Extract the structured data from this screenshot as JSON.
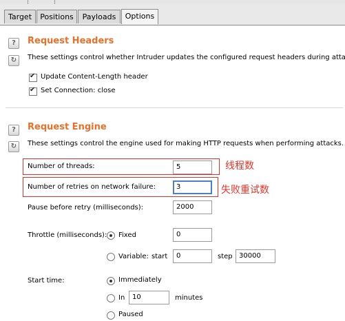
{
  "tabs": [
    {
      "label": "Target"
    },
    {
      "label": "Positions"
    },
    {
      "label": "Payloads"
    },
    {
      "label": "Options",
      "active": true
    }
  ],
  "request_headers": {
    "title": "Request Headers",
    "description": "These settings control whether Intruder updates the configured request headers during attacks.",
    "options": [
      {
        "label": "Update Content-Length header",
        "checked": true
      },
      {
        "label": "Set Connection: close",
        "checked": true
      }
    ]
  },
  "request_engine": {
    "title": "Request Engine",
    "description": "These settings control the engine used for making HTTP requests when performing attacks.",
    "threads": {
      "label": "Number of threads:",
      "value": "5",
      "annotation": "线程数"
    },
    "retries": {
      "label": "Number of retries on network failure:",
      "value": "3",
      "annotation": "失败重试数"
    },
    "pause": {
      "label": "Pause before retry (milliseconds):",
      "value": "2000"
    },
    "throttle": {
      "label": "Throttle (milliseconds):",
      "fixed_label": "Fixed",
      "fixed_value": "0",
      "fixed_selected": true,
      "variable_label": "Variable:",
      "start_label": "start",
      "start_value": "0",
      "step_label": "step",
      "step_value": "30000"
    },
    "start_time": {
      "label": "Start time:",
      "immediately_label": "Immediately",
      "immediately_selected": true,
      "in_label": "In",
      "in_value": "10",
      "minutes_label": "minutes",
      "paused_label": "Paused"
    }
  },
  "icons": {
    "help": "question-mark",
    "reset": "reset-arrows"
  },
  "colors": {
    "section_title": "#e8702a",
    "annotation": "#d9342b",
    "focus": "#4a7fd0"
  }
}
